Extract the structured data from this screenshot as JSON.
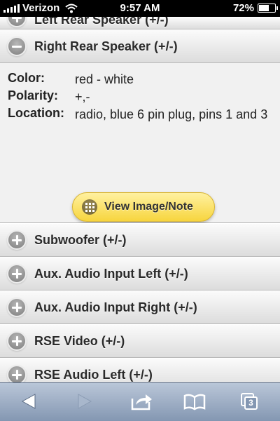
{
  "status_bar": {
    "carrier": "Verizon",
    "time": "9:57 AM",
    "battery_percent": "72%",
    "signal_bars": 4,
    "wifi_icon": "wifi-icon",
    "battery_level": 0.72
  },
  "sections": {
    "partial_top": {
      "label": "Left Rear Speaker (+/-)",
      "icon": "plus-circle-icon"
    },
    "expanded": {
      "label": "Right Rear Speaker (+/-)",
      "icon": "minus-circle-icon",
      "details": [
        {
          "key": "Color:",
          "value": "red - white"
        },
        {
          "key": "Polarity:",
          "value": "+,-"
        },
        {
          "key": "Location:",
          "value": "radio, blue 6 pin plug, pins 1 and 3"
        }
      ],
      "button_label": "View Image/Note",
      "button_icon": "grid-icon"
    },
    "collapsed": [
      {
        "label": "Subwoofer (+/-)",
        "icon": "plus-circle-icon"
      },
      {
        "label": "Aux. Audio Input Left (+/-)",
        "icon": "plus-circle-icon"
      },
      {
        "label": "Aux. Audio Input Right (+/-)",
        "icon": "plus-circle-icon"
      },
      {
        "label": "RSE Video (+/-)",
        "icon": "plus-circle-icon"
      },
      {
        "label": "RSE Audio Left (+/-)",
        "icon": "plus-circle-icon"
      }
    ]
  },
  "toolbar": {
    "back_icon": "back-arrow-icon",
    "forward_icon": "forward-arrow-icon",
    "share_icon": "share-icon",
    "bookmarks_icon": "bookmarks-icon",
    "tabs_icon": "tabs-icon",
    "tabs_count": "3"
  },
  "colors": {
    "button_yellow": "#f7d53e",
    "toolbar_blue": "#8497b2"
  }
}
